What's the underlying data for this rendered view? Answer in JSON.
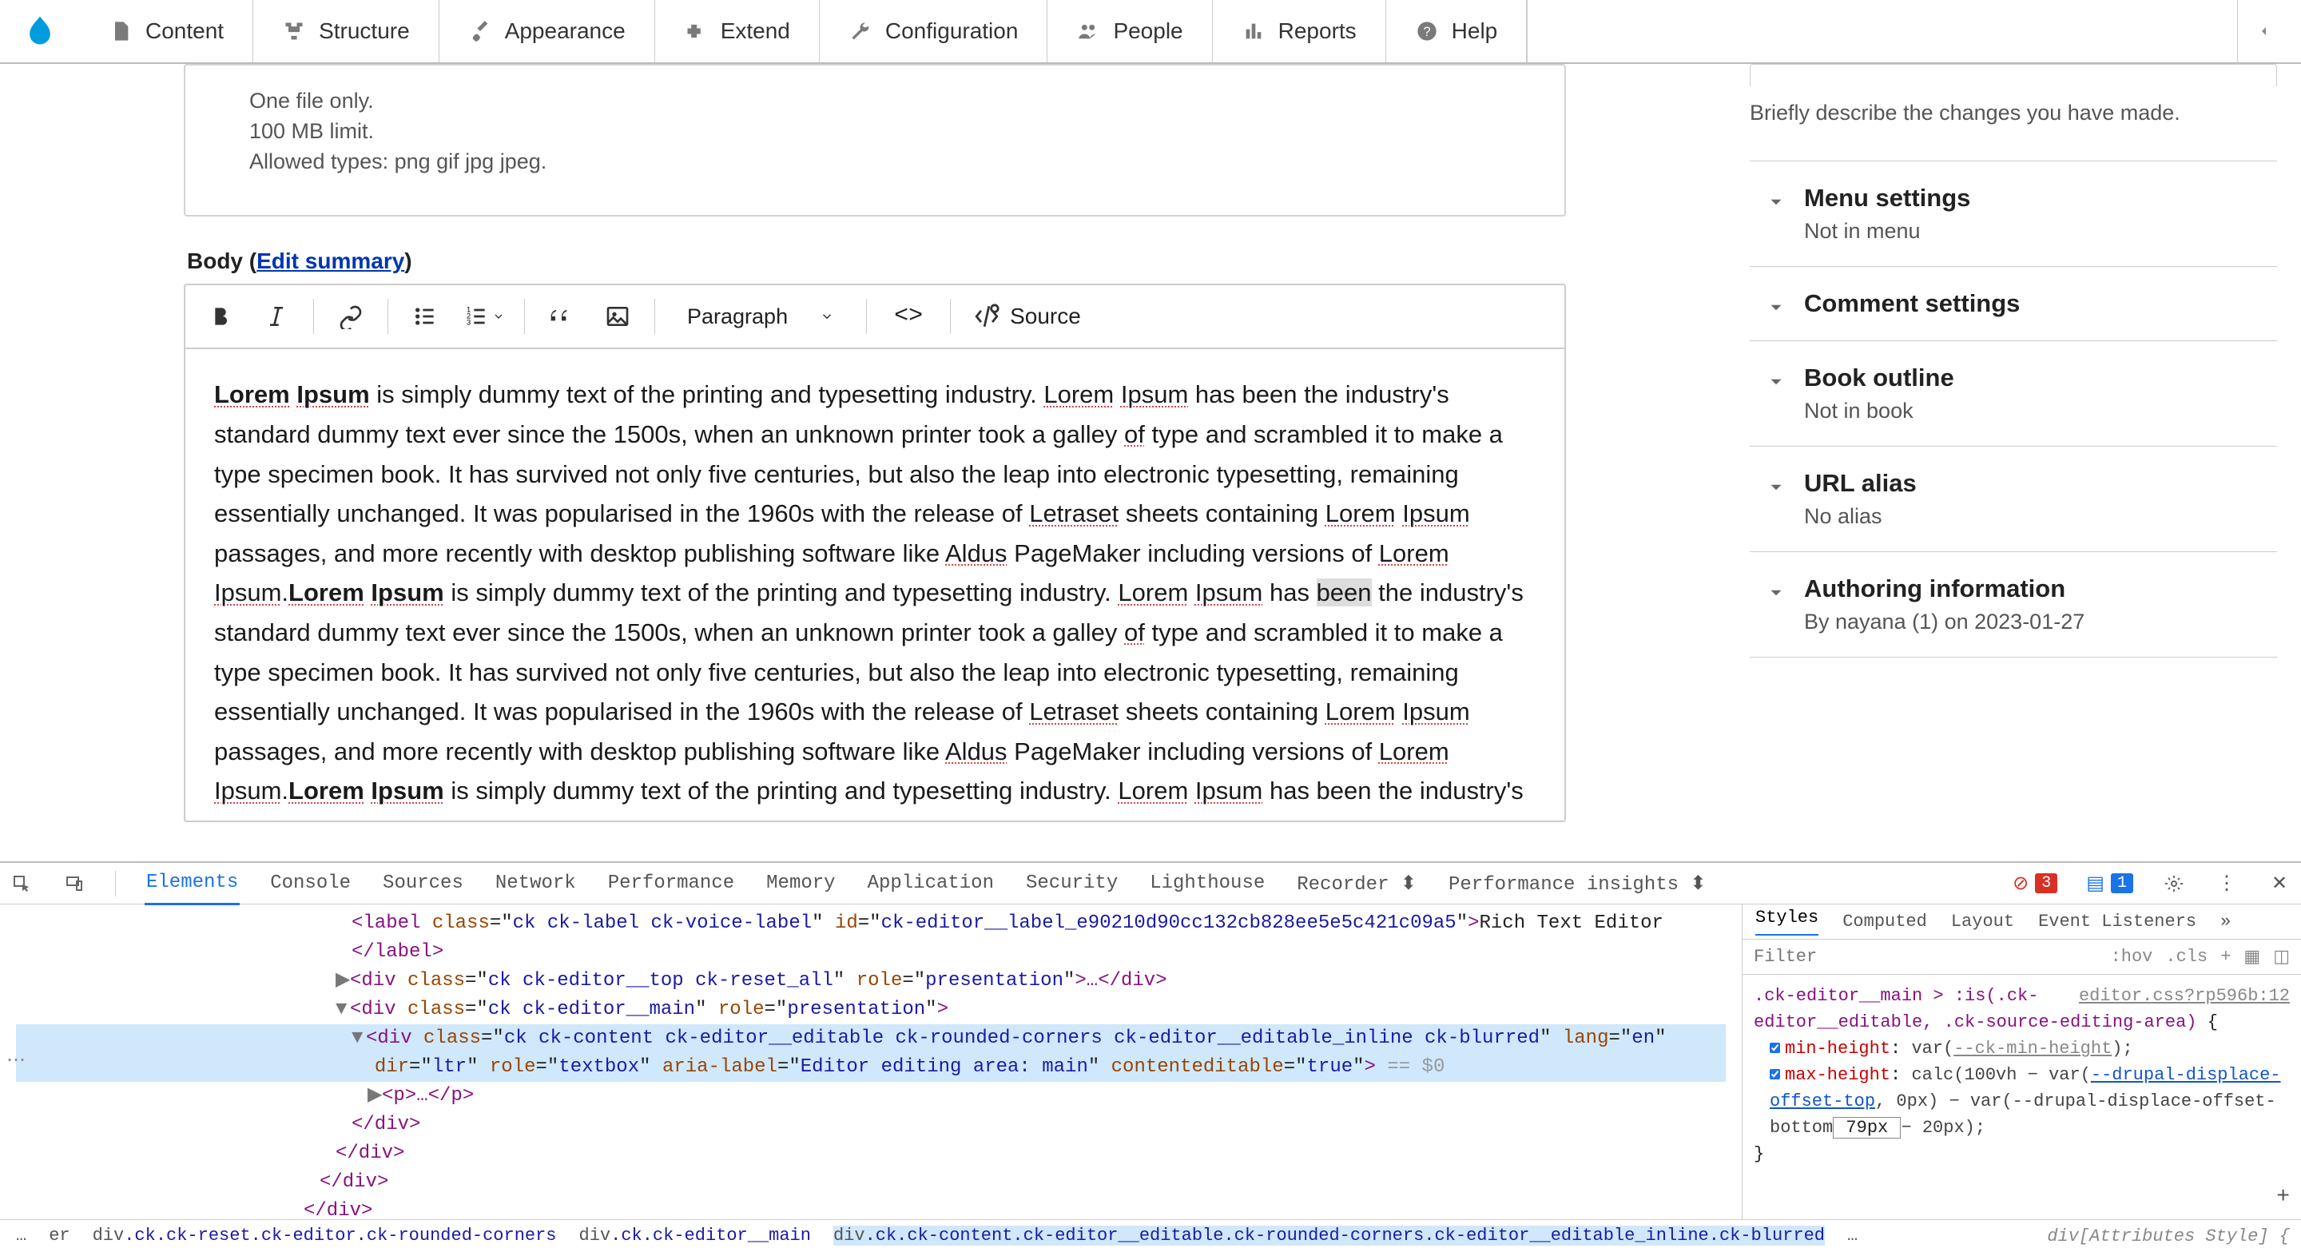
{
  "toolbar": {
    "items": [
      "Content",
      "Structure",
      "Appearance",
      "Extend",
      "Configuration",
      "People",
      "Reports",
      "Help"
    ]
  },
  "file_help": {
    "l1": "One file only.",
    "l2": "100 MB limit.",
    "l3": "Allowed types: png gif jpg jpeg."
  },
  "body": {
    "label_prefix": "Body (",
    "edit_summary": "Edit summary",
    "label_suffix": ")",
    "heading_ph": "Paragraph",
    "source": "Source"
  },
  "editor_text": {
    "p1a": " is simply dummy text of the printing and typesetting industry. ",
    "p1b": " has been the industry's standard dummy text ever since the 1500s, when an unknown printer took a galley ",
    "p1c": " type and scrambled it to make a type specimen book. It has survived not only five centuries, but also the leap into electronic typesetting, remaining essentially unchanged. It was popularised in the 1960s with the release of ",
    "p1d": " sheets containing ",
    "p1e": " passages, and more recently with desktop publishing software like ",
    "p1f": " PageMaker including versions of ",
    "p2a": " is simply dummy text of the printing and typesetting industry. ",
    "p2b": " has ",
    "p2c": " the industry's standard dummy text ever since the 1500s, when an unknown printer took a galley ",
    "p2d": " type and scrambled it to make a type specimen book. It has survived not only five centuries, but also the leap into electronic typesetting, remaining essentially unchanged. It was popularised in the 1960s with the release of ",
    "p2e": " sheets containing ",
    "p2f": " passages, and more recently with desktop publishing software like ",
    "p2g": " PageMaker including versions of ",
    "p3a": " is simply dummy text of the printing and typesetting industry. ",
    "p3b": " has been the industry's standard dummy text",
    "words": {
      "lorem": "Lorem",
      "ipsum": "Ipsum",
      "lorem_ipsum": "Lorem Ipsum",
      "of": "of",
      "letraset": "Letraset",
      "aldus": "Aldus",
      "been": "been"
    }
  },
  "sidebar": {
    "log_help": "Briefly describe the changes you have made.",
    "items": [
      {
        "title": "Menu settings",
        "sub": "Not in menu"
      },
      {
        "title": "Comment settings",
        "sub": ""
      },
      {
        "title": "Book outline",
        "sub": "Not in book"
      },
      {
        "title": "URL alias",
        "sub": "No alias"
      },
      {
        "title": "Authoring information",
        "sub": "By nayana (1) on 2023-01-27"
      }
    ]
  },
  "devtools": {
    "tabs": [
      "Elements",
      "Console",
      "Sources",
      "Network",
      "Performance",
      "Memory",
      "Application",
      "Security",
      "Lighthouse",
      "Recorder",
      "Performance insights"
    ],
    "err_count": "3",
    "info_count": "1",
    "style_tabs": [
      "Styles",
      "Computed",
      "Layout",
      "Event Listeners"
    ],
    "filter_ph": "Filter",
    "hov": ":hov",
    "cls": ".cls",
    "src_file": "editor.css?rp596b:12",
    "selector": ".ck-editor__main > :is(.ck-editor__editable, .ck-source-editing-area)",
    "rule_open": " {",
    "prop1": "min-height",
    "val1a": "var(",
    "val1b": "--ck-min-height",
    "val1c": ");",
    "prop2": "max-height",
    "val2a": "calc(100vh − var(",
    "val2b": "--drupal-displace-offset-top",
    "val2c": ", 0px) − var(--drupal-displace-offset-bottom",
    "val2d": " 79px ",
    "val2e": " − 20px);",
    "rule_close": "}",
    "dom": {
      "l0a": "<label class=\"",
      "l0b": "ck ck-label ck-voice-label",
      "l0c": "\" id=\"",
      "l0d": "ck-editor__label_e90210d90cc132cb828ee5e5c421c09a5",
      "l0e": "\">Rich Text Editor",
      "l0f": "</label>",
      "l1a": "<div class=\"",
      "l1b": "ck ck-editor__top ck-reset_all",
      "l1c": "\" role=\"",
      "l1d": "presentation",
      "l1e": "\">…</div>",
      "l2a": "<div class=\"",
      "l2b": "ck ck-editor__main",
      "l2c": "\" role=\"",
      "l2d": "presentation",
      "l2e": "\">",
      "l3a": "<div class=\"",
      "l3b": "ck ck-content ck-editor__editable ck-rounded-corners ck-editor__editable_inline ck-blurred",
      "l3c": "\" lang=\"",
      "l3d": "en",
      "l3e": "\"",
      "l3f": "dir=\"",
      "l3g": "ltr",
      "l3h": "\" role=\"",
      "l3i": "textbox",
      "l3j": "\" aria-label=\"",
      "l3k": "Editor editing area: main",
      "l3l": "\" contenteditable=\"",
      "l3m": "true",
      "l3n": "\">",
      "l3eq": " == $0",
      "l4": "<p>…</p>",
      "l5": "</div>",
      "l6": "</div>",
      "l7": "</div>",
      "l8": "</div>",
      "l9": "</div>"
    },
    "crumbs": {
      "c0": "…",
      "c1a": "er",
      "c2a": "div",
      "c2b": ".ck.ck-reset.ck-editor.ck-rounded-corners",
      "c3a": "div",
      "c3b": ".ck.ck-editor__main",
      "c4a": "div",
      "c4b": ".ck.ck-content.ck-editor__editable.ck-rounded-corners.ck-editor__editable_inline.ck-blurred",
      "c5": "…",
      "attr_style": "div[Attributes Style] {"
    }
  }
}
